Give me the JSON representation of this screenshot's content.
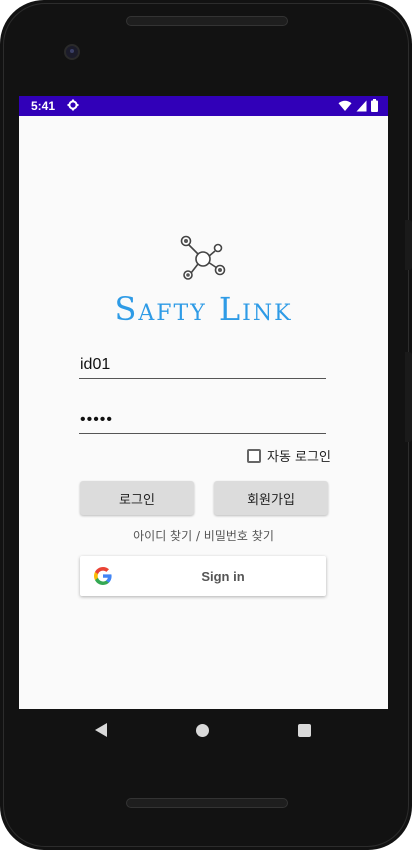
{
  "status_bar": {
    "time": "5:41",
    "settings_icon": "gear-icon",
    "wifi_icon": "wifi-icon",
    "signal_icon": "cell-signal-icon",
    "battery_icon": "battery-icon",
    "background_color": "#3100b8"
  },
  "app": {
    "logo_icon": "network-link-icon",
    "title": "Safty Link",
    "title_color": "#2e9be6"
  },
  "login_form": {
    "id_value": "id01",
    "password_value": "•••••",
    "auto_login_label": "자동 로그인",
    "auto_login_checked": false,
    "login_button": "로그인",
    "signup_button": "회원가입",
    "find_account_link": "아이디 찾기 / 비밀번호 찾기"
  },
  "google_signin": {
    "icon": "google-icon",
    "label": "Sign in"
  },
  "navigation_bar": {
    "back_icon": "back-triangle-icon",
    "home_icon": "home-circle-icon",
    "recents_icon": "recents-square-icon"
  }
}
